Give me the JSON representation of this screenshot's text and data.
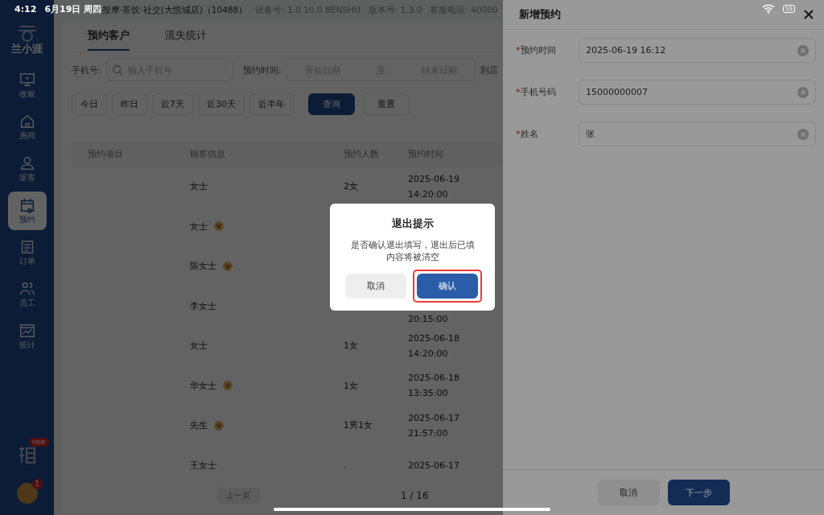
{
  "status_bar": {
    "time": "4:12",
    "date": "6月19日 周四",
    "battery": "55"
  },
  "header": {
    "store": "按摩·茶饮·社交(大悦城店)（10488）",
    "device": "设备号: 1.0.10.0.BENSHU",
    "version": "版本号: 1.3.0",
    "phone": "客服电话: 40000"
  },
  "sidebar": {
    "logo": "兰小涯",
    "items": [
      {
        "label": "收银",
        "selected": false
      },
      {
        "label": "房间",
        "selected": false
      },
      {
        "label": "派客",
        "selected": false
      },
      {
        "label": "预约",
        "selected": true
      },
      {
        "label": "订单",
        "selected": false
      },
      {
        "label": "员工",
        "selected": false
      },
      {
        "label": "统计",
        "selected": false
      }
    ],
    "new_badge": "new",
    "avatar_badge": "1"
  },
  "tabs": [
    {
      "label": "预约客户",
      "selected": true
    },
    {
      "label": "流失统计",
      "selected": false
    }
  ],
  "filters": {
    "phone_label": "手机号:",
    "phone_placeholder": "输入手机号",
    "time_label": "预约时间:",
    "start_placeholder": "开始日期",
    "to": "至",
    "end_placeholder": "结束日期",
    "arrive_label": "到店"
  },
  "quick_buttons": [
    "今日",
    "昨日",
    "近7天",
    "近30天",
    "近半年"
  ],
  "query": "查询",
  "reset": "重置",
  "table": {
    "columns": [
      "预约项目",
      "顾客信息",
      "预约人数",
      "预约时间"
    ],
    "rows": [
      {
        "name": "女士",
        "vip": false,
        "count": "2女",
        "date": "2025-06-19",
        "time": "14:20:00"
      },
      {
        "name": "女士",
        "vip": true
      },
      {
        "name": "陈女士",
        "vip": true
      },
      {
        "name": "李女士",
        "vip": false,
        "time": "20:15:00"
      },
      {
        "name": "女士",
        "vip": false,
        "count": "1女",
        "date": "2025-06-18",
        "time": "14:20:00"
      },
      {
        "name": "华女士",
        "vip": true,
        "count": "1女",
        "date": "2025-06-18",
        "time": "13:35:00"
      },
      {
        "name": "先生",
        "vip": true,
        "count": "1男1女",
        "date": "2025-06-17",
        "time": "21:57:00"
      },
      {
        "name": "王女士",
        "vip": false,
        "count": ".",
        "date": "2025-06-17"
      }
    ]
  },
  "pagination": {
    "prev": "上一页",
    "page": "1 / 16"
  },
  "drawer": {
    "title": "新增预约",
    "fields": [
      {
        "required_mark": "*",
        "label": "预约时间",
        "value": "2025-06-19 16:12"
      },
      {
        "required_mark": "*",
        "label": "手机号码",
        "value": "15000000007"
      },
      {
        "required_mark": "*",
        "label": "姓名",
        "value": "张"
      }
    ],
    "cancel": "取消",
    "next": "下一步"
  },
  "dialog": {
    "title": "退出提示",
    "message": "是否确认退出填写，退出后已填内容将被清空",
    "cancel": "取消",
    "confirm": "确认"
  }
}
